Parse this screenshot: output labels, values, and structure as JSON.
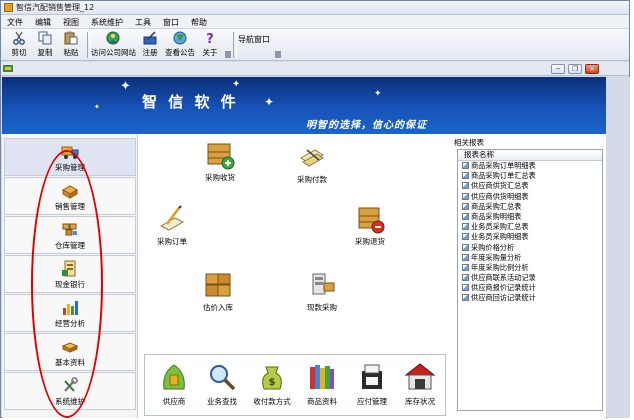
{
  "window": {
    "title": "智信汽配销售管理_12"
  },
  "menu": [
    "文件",
    "编辑",
    "视图",
    "系统维护",
    "工具",
    "窗口",
    "帮助"
  ],
  "toolbar": {
    "buttons": [
      {
        "label": "剪切",
        "icon": "scissors-icon"
      },
      {
        "label": "复制",
        "icon": "copy-icon"
      },
      {
        "label": "粘贴",
        "icon": "paste-icon"
      },
      {
        "label": "访问公司网站",
        "icon": "globe-user-icon"
      },
      {
        "label": "注册",
        "icon": "register-pen-icon"
      },
      {
        "label": "查看公告",
        "icon": "earth-icon"
      },
      {
        "label": "关于",
        "icon": "help-icon"
      }
    ],
    "nav_window_label": "导航窗口"
  },
  "mdi_buttons": {
    "minimize": "−",
    "restore": "❐",
    "close": "×"
  },
  "banner": {
    "brand": "智 信 软 件",
    "slogan": "明智的选择，信心的保证"
  },
  "sidebar": {
    "items": [
      {
        "label": "采购管理",
        "icon": "truck-icon",
        "active": true
      },
      {
        "label": "销售管理",
        "icon": "box-sales-icon",
        "active": false
      },
      {
        "label": "仓库管理",
        "icon": "warehouse-icon",
        "active": false
      },
      {
        "label": "现金银行",
        "icon": "cash-bank-icon",
        "active": false
      },
      {
        "label": "经营分析",
        "icon": "bar-chart-icon",
        "active": false
      },
      {
        "label": "基本资料",
        "icon": "basic-data-icon",
        "active": false
      },
      {
        "label": "系统维护",
        "icon": "wrench-icon",
        "active": false
      }
    ]
  },
  "workflow": {
    "items": [
      {
        "label": "采购收货",
        "icon": "receive-box-icon"
      },
      {
        "label": "采购付款",
        "icon": "payment-icon"
      },
      {
        "label": "采购订单",
        "icon": "order-pen-icon"
      },
      {
        "label": "采购退货",
        "icon": "return-box-icon"
      },
      {
        "label": "估价入库",
        "icon": "stock-in-icon"
      },
      {
        "label": "现款采购",
        "icon": "cash-purchase-icon"
      }
    ]
  },
  "bottom_bar": {
    "items": [
      {
        "label": "供应商",
        "icon": "supplier-icon"
      },
      {
        "label": "业务查找",
        "icon": "magnifier-icon"
      },
      {
        "label": "收付款方式",
        "icon": "money-bag-icon"
      },
      {
        "label": "商品资料",
        "icon": "books-icon"
      },
      {
        "label": "应付管理",
        "icon": "payable-icon"
      },
      {
        "label": "库存状况",
        "icon": "storehouse-icon"
      }
    ]
  },
  "reports": {
    "title": "相关报表",
    "column_header": "报表名称",
    "items": [
      "商品采购订单明细表",
      "商品采购订单汇总表",
      "供应商供货汇总表",
      "供应商供货明细表",
      "商品采购汇总表",
      "商品采购明细表",
      "业务员采购汇总表",
      "业务员采购明细表",
      "采购价格分析",
      "年度采购量分析",
      "年度采购比例分析",
      "供应商联系活动记录",
      "供应商报价记录统计",
      "供应商回访记录统计"
    ]
  },
  "colors": {
    "banner_dark": "#0b2f7a",
    "banner_light": "#1b64c9",
    "highlight_ring": "#e00000",
    "active_nav": "#dfe3f2"
  }
}
